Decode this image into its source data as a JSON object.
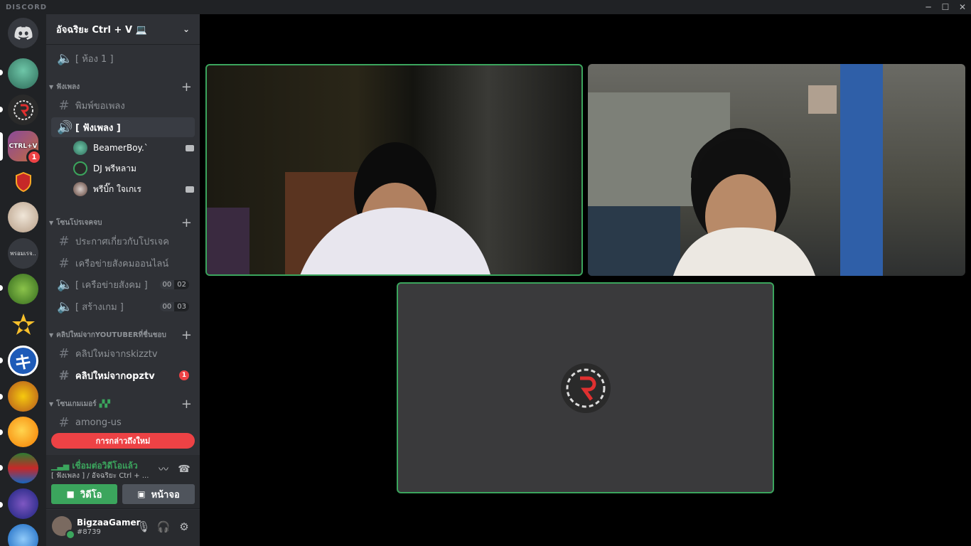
{
  "app": {
    "brand": "DISCORD",
    "window_buttons": [
      "─",
      "☐",
      "✕"
    ]
  },
  "server": {
    "name": "อัจฉริยะ Ctrl + V 💻"
  },
  "channels": {
    "room1": "[ ห้อง 1 ]",
    "cat_music": "ฟังเพลง",
    "music_request": "พิมพ์ขอเพลง",
    "music_voice": "[ ฟังเพลง ]",
    "users": [
      "BeamerBoy.`",
      "DJ พรีหลาม",
      "พรีบิ๊ก ใจเกเร"
    ],
    "cat_project": "โซนโปรเจคจบ",
    "project_announce": "ประกาศเกี่ยวกับโปรเจค",
    "project_network": "เครือข่ายสังคมออนไลน์",
    "voice_social": "[ เครือข่ายสังคม ]",
    "voice_social_count": [
      "00",
      "02"
    ],
    "voice_game": "[ สร้างเกม ]",
    "voice_game_count": [
      "00",
      "03"
    ],
    "cat_youtube": "คลิปใหม่จากYOUTUBERที่ชื่นชอบ",
    "yt_skizz": "คลิปใหม่จากskizztv",
    "yt_opz": "คลิปใหม่จากopztv",
    "yt_opz_badge": "1",
    "cat_gamer": "โซนเกมเมอร์",
    "among_us": "among-us",
    "new_mentions": "การกล่าวถึงใหม่"
  },
  "voice_panel": {
    "status": "เชื่อมต่อวิดีโอแล้ว",
    "location": "[ ฟังเพลง ] / อัจฉริยะ Ctrl + ...",
    "video_label": "วิดีโอ",
    "screen_label": "หน้าจอ"
  },
  "user": {
    "name": "BigzaaGamer",
    "tag": "#8739"
  },
  "guild_badges": {
    "mentions": "1",
    "small_label": "พรอมเรจ.."
  },
  "colors": {
    "accent_green": "#3ba55d",
    "mention_red": "#ed4245",
    "sidebar": "#2f3136",
    "guild_bar": "#202225"
  }
}
